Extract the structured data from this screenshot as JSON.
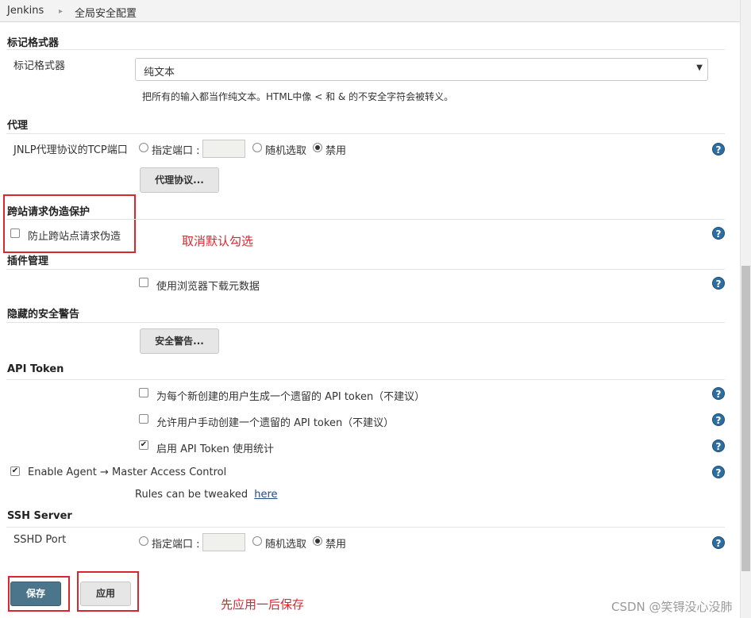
{
  "breadcrumb": {
    "root": "Jenkins",
    "separator": "▸",
    "current": "全局安全配置"
  },
  "markup": {
    "title": "标记格式器",
    "label": "标记格式器",
    "selected": "纯文本",
    "description": "把所有的输入都当作纯文本。HTML中像 < 和 & 的不安全字符会被转义。"
  },
  "proxy": {
    "title": "代理",
    "label": "JNLP代理协议的TCP端口",
    "opt_fixed": "指定端口 :",
    "opt_random": "随机选取",
    "opt_disable": "禁用",
    "selected": "禁用",
    "button": "代理协议..."
  },
  "csrf": {
    "title": "跨站请求伪造保护",
    "checkbox": "防止跨站点请求伪造",
    "checked": false,
    "annotation": "取消默认勾选"
  },
  "plugin": {
    "title": "插件管理",
    "checkbox": "使用浏览器下载元数据",
    "checked": false
  },
  "hidden_warnings": {
    "title": "隐藏的安全警告",
    "button": "安全警告..."
  },
  "api_token": {
    "title": "API Token",
    "items": [
      {
        "label": "为每个新创建的用户生成一个遗留的 API token（不建议）",
        "checked": false
      },
      {
        "label": "允许用户手动创建一个遗留的 API token（不建议）",
        "checked": false
      },
      {
        "label": "启用 API Token 使用统计",
        "checked": true
      }
    ]
  },
  "agent": {
    "checkbox": "Enable Agent → Master Access Control",
    "checked": true,
    "rules_text": "Rules can be tweaked",
    "rules_link": "here"
  },
  "ssh": {
    "title": "SSH Server",
    "label": "SSHD Port",
    "opt_fixed": "指定端口 :",
    "opt_random": "随机选取",
    "opt_disable": "禁用",
    "selected": "禁用"
  },
  "buttons": {
    "save": "保存",
    "apply": "应用"
  },
  "annotations": {
    "bottom": "先应用一后保存"
  },
  "help_glyph": "?",
  "check_glyph": "✔",
  "watermark": "CSDN @笑锝没心没肺",
  "colors": {
    "accent": "#4b758b",
    "help": "#2c6ea0",
    "annotation": "#d9272d"
  }
}
